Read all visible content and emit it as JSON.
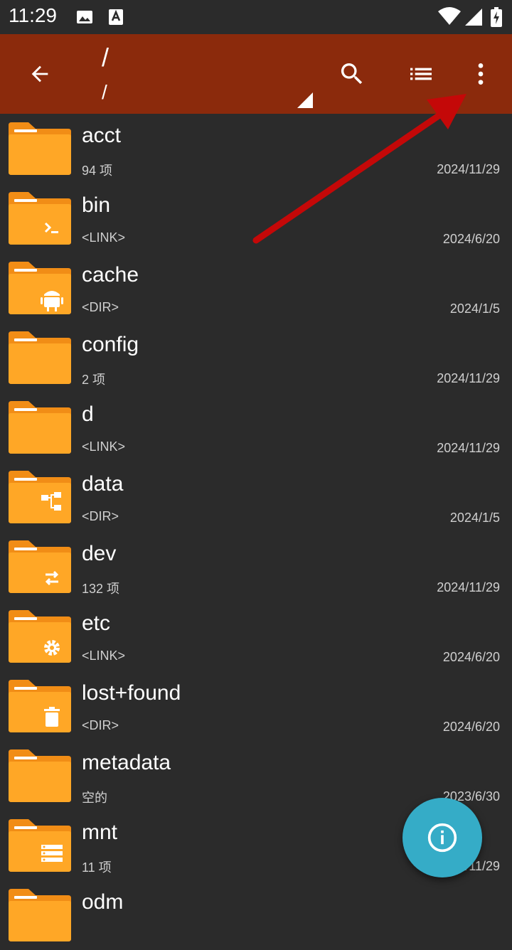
{
  "status_bar": {
    "time": "11:29"
  },
  "toolbar": {
    "path_title": "/",
    "path_subtitle": "/"
  },
  "files": [
    {
      "name": "acct",
      "meta": "94 项",
      "date": "2024/11/29",
      "badge": ""
    },
    {
      "name": "bin",
      "meta": "<LINK>",
      "date": "2024/6/20",
      "badge": "terminal-icon"
    },
    {
      "name": "cache",
      "meta": "<DIR>",
      "date": "2024/1/5",
      "badge": "android-icon"
    },
    {
      "name": "config",
      "meta": "2 项",
      "date": "2024/11/29",
      "badge": ""
    },
    {
      "name": "d",
      "meta": "<LINK>",
      "date": "2024/11/29",
      "badge": ""
    },
    {
      "name": "data",
      "meta": "<DIR>",
      "date": "2024/1/5",
      "badge": "tree-icon"
    },
    {
      "name": "dev",
      "meta": "132 项",
      "date": "2024/11/29",
      "badge": "swap-icon"
    },
    {
      "name": "etc",
      "meta": "<LINK>",
      "date": "2024/6/20",
      "badge": "gear-icon"
    },
    {
      "name": "lost+found",
      "meta": "<DIR>",
      "date": "2024/6/20",
      "badge": "trash-icon"
    },
    {
      "name": "metadata",
      "meta": "空的",
      "date": "2023/6/30",
      "badge": ""
    },
    {
      "name": "mnt",
      "meta": "11 项",
      "date": "2024/11/29",
      "badge": "storage-icon"
    },
    {
      "name": "odm",
      "meta": "",
      "date": "",
      "badge": ""
    }
  ],
  "colors": {
    "toolbar": "#8b2a0c",
    "background": "#2b2b2b",
    "folder": "#ffa726",
    "folder_tab": "#f18d16",
    "fab": "#35acc7",
    "annotation_arrow": "#c40808"
  }
}
